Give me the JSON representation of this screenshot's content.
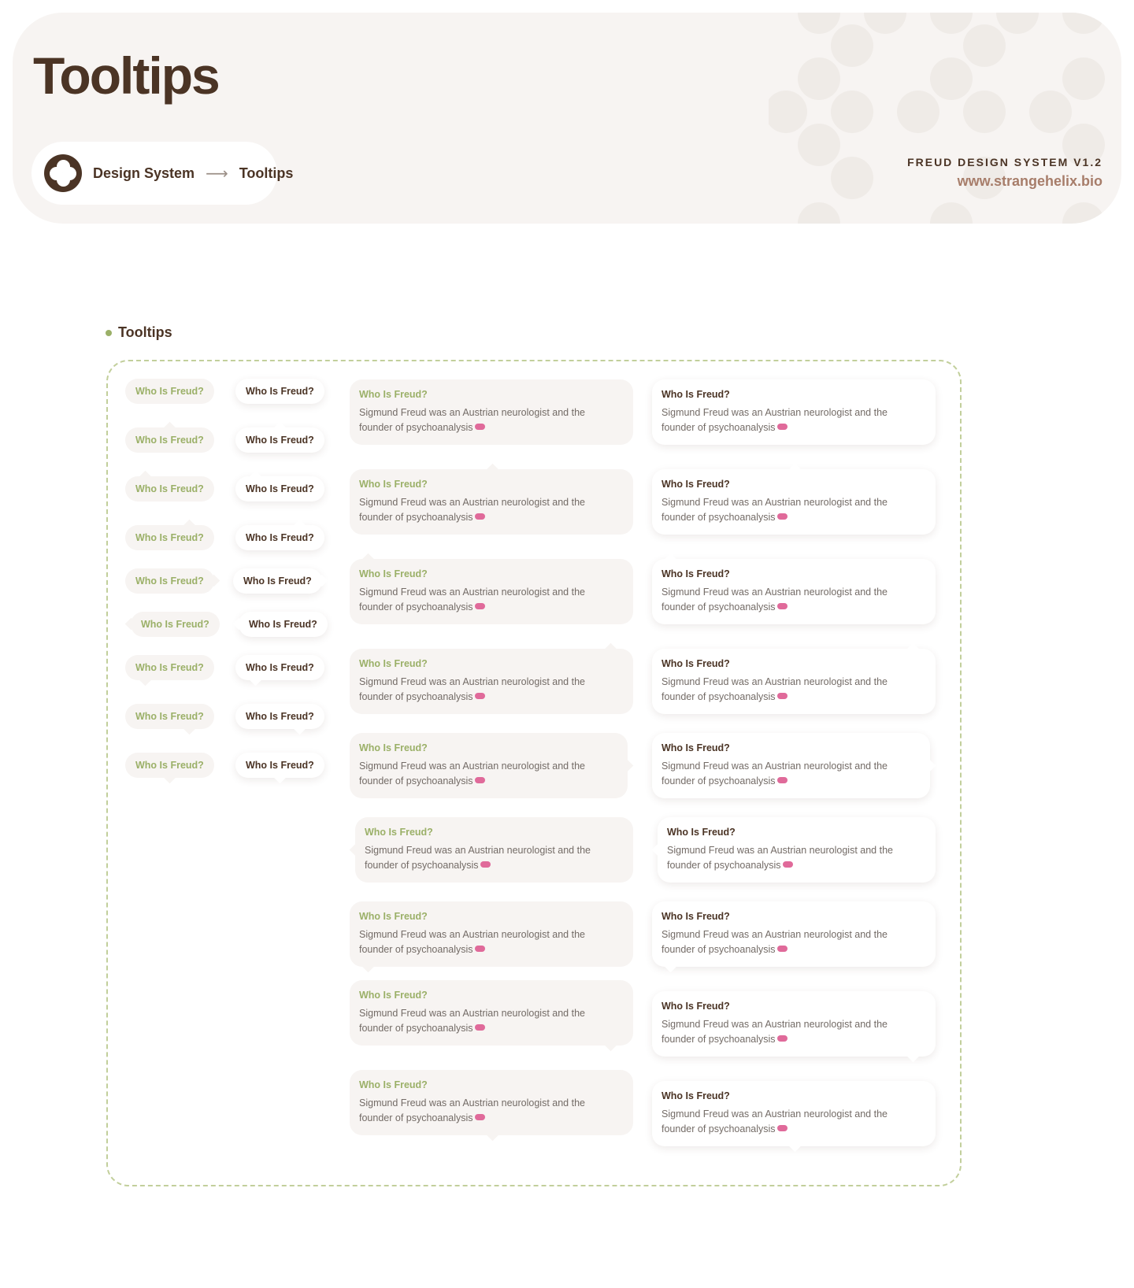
{
  "header": {
    "title": "Tooltips",
    "breadcrumb": {
      "root": "Design System",
      "current": "Tooltips"
    },
    "brand_name": "FREUD DESIGN SYSTEM V1.2",
    "brand_url": "www.strangehelix.bio"
  },
  "section": {
    "label": "Tooltips"
  },
  "tooltip": {
    "title": "Who Is Freud?",
    "body": "Sigmund Freud was an Austrian neurologist and the founder of psychoanalysis"
  },
  "colors": {
    "brown": "#4b3425",
    "green": "#9bb068",
    "cream": "#f7f4f2",
    "brown_light": "#a77d6a"
  }
}
